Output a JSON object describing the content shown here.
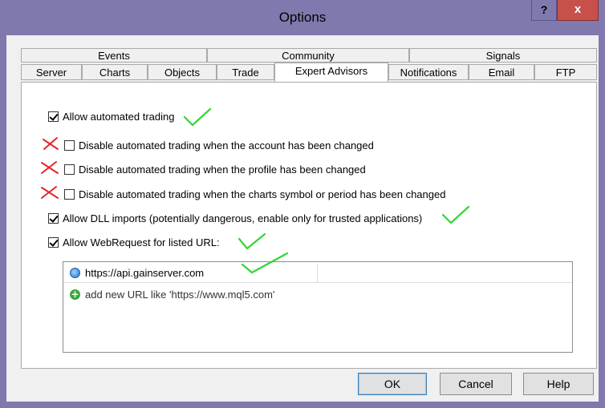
{
  "window": {
    "title": "Options",
    "help_button": "?",
    "close_button": "x"
  },
  "tabs": {
    "row1": [
      "Events",
      "Community",
      "Signals"
    ],
    "row2": [
      "Server",
      "Charts",
      "Objects",
      "Trade",
      "Expert Advisors",
      "Notifications",
      "Email",
      "FTP"
    ],
    "active": "Expert Advisors"
  },
  "options": [
    {
      "label": "Allow automated trading",
      "checked": true,
      "annotation": "green-check"
    },
    {
      "label": "Disable automated trading when the account has been changed",
      "checked": false,
      "annotation": "red-x"
    },
    {
      "label": "Disable automated trading when the profile has been changed",
      "checked": false,
      "annotation": "red-x"
    },
    {
      "label": "Disable automated trading when the charts symbol or period has been changed",
      "checked": false,
      "annotation": "red-x"
    },
    {
      "label": "Allow DLL imports (potentially dangerous, enable only for trusted applications)",
      "checked": true,
      "annotation": "green-check"
    },
    {
      "label": "Allow WebRequest for listed URL:",
      "checked": true,
      "annotation": "green-check"
    }
  ],
  "url_list": {
    "entries": [
      "https://api.gainserver.com"
    ],
    "add_placeholder": "add new URL like 'https://www.mql5.com'"
  },
  "buttons": {
    "ok": "OK",
    "cancel": "Cancel",
    "help": "Help"
  },
  "colors": {
    "titlebar": "#7f79ad",
    "close": "#c7504a",
    "annotation_green": "#33d633",
    "annotation_red": "#e5252a"
  }
}
